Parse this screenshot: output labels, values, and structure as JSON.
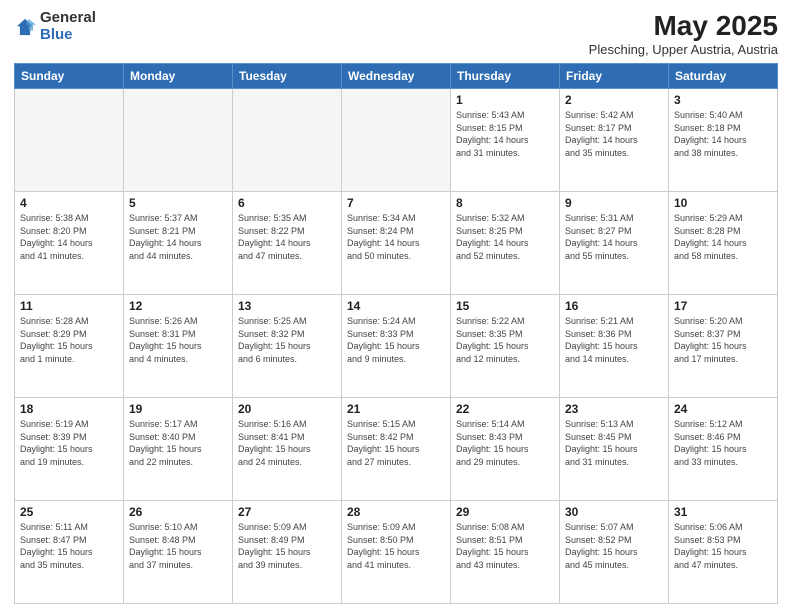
{
  "header": {
    "logo_general": "General",
    "logo_blue": "Blue",
    "title": "May 2025",
    "subtitle": "Plesching, Upper Austria, Austria"
  },
  "days_of_week": [
    "Sunday",
    "Monday",
    "Tuesday",
    "Wednesday",
    "Thursday",
    "Friday",
    "Saturday"
  ],
  "weeks": [
    [
      {
        "day": "",
        "info": ""
      },
      {
        "day": "",
        "info": ""
      },
      {
        "day": "",
        "info": ""
      },
      {
        "day": "",
        "info": ""
      },
      {
        "day": "1",
        "info": "Sunrise: 5:43 AM\nSunset: 8:15 PM\nDaylight: 14 hours\nand 31 minutes."
      },
      {
        "day": "2",
        "info": "Sunrise: 5:42 AM\nSunset: 8:17 PM\nDaylight: 14 hours\nand 35 minutes."
      },
      {
        "day": "3",
        "info": "Sunrise: 5:40 AM\nSunset: 8:18 PM\nDaylight: 14 hours\nand 38 minutes."
      }
    ],
    [
      {
        "day": "4",
        "info": "Sunrise: 5:38 AM\nSunset: 8:20 PM\nDaylight: 14 hours\nand 41 minutes."
      },
      {
        "day": "5",
        "info": "Sunrise: 5:37 AM\nSunset: 8:21 PM\nDaylight: 14 hours\nand 44 minutes."
      },
      {
        "day": "6",
        "info": "Sunrise: 5:35 AM\nSunset: 8:22 PM\nDaylight: 14 hours\nand 47 minutes."
      },
      {
        "day": "7",
        "info": "Sunrise: 5:34 AM\nSunset: 8:24 PM\nDaylight: 14 hours\nand 50 minutes."
      },
      {
        "day": "8",
        "info": "Sunrise: 5:32 AM\nSunset: 8:25 PM\nDaylight: 14 hours\nand 52 minutes."
      },
      {
        "day": "9",
        "info": "Sunrise: 5:31 AM\nSunset: 8:27 PM\nDaylight: 14 hours\nand 55 minutes."
      },
      {
        "day": "10",
        "info": "Sunrise: 5:29 AM\nSunset: 8:28 PM\nDaylight: 14 hours\nand 58 minutes."
      }
    ],
    [
      {
        "day": "11",
        "info": "Sunrise: 5:28 AM\nSunset: 8:29 PM\nDaylight: 15 hours\nand 1 minute."
      },
      {
        "day": "12",
        "info": "Sunrise: 5:26 AM\nSunset: 8:31 PM\nDaylight: 15 hours\nand 4 minutes."
      },
      {
        "day": "13",
        "info": "Sunrise: 5:25 AM\nSunset: 8:32 PM\nDaylight: 15 hours\nand 6 minutes."
      },
      {
        "day": "14",
        "info": "Sunrise: 5:24 AM\nSunset: 8:33 PM\nDaylight: 15 hours\nand 9 minutes."
      },
      {
        "day": "15",
        "info": "Sunrise: 5:22 AM\nSunset: 8:35 PM\nDaylight: 15 hours\nand 12 minutes."
      },
      {
        "day": "16",
        "info": "Sunrise: 5:21 AM\nSunset: 8:36 PM\nDaylight: 15 hours\nand 14 minutes."
      },
      {
        "day": "17",
        "info": "Sunrise: 5:20 AM\nSunset: 8:37 PM\nDaylight: 15 hours\nand 17 minutes."
      }
    ],
    [
      {
        "day": "18",
        "info": "Sunrise: 5:19 AM\nSunset: 8:39 PM\nDaylight: 15 hours\nand 19 minutes."
      },
      {
        "day": "19",
        "info": "Sunrise: 5:17 AM\nSunset: 8:40 PM\nDaylight: 15 hours\nand 22 minutes."
      },
      {
        "day": "20",
        "info": "Sunrise: 5:16 AM\nSunset: 8:41 PM\nDaylight: 15 hours\nand 24 minutes."
      },
      {
        "day": "21",
        "info": "Sunrise: 5:15 AM\nSunset: 8:42 PM\nDaylight: 15 hours\nand 27 minutes."
      },
      {
        "day": "22",
        "info": "Sunrise: 5:14 AM\nSunset: 8:43 PM\nDaylight: 15 hours\nand 29 minutes."
      },
      {
        "day": "23",
        "info": "Sunrise: 5:13 AM\nSunset: 8:45 PM\nDaylight: 15 hours\nand 31 minutes."
      },
      {
        "day": "24",
        "info": "Sunrise: 5:12 AM\nSunset: 8:46 PM\nDaylight: 15 hours\nand 33 minutes."
      }
    ],
    [
      {
        "day": "25",
        "info": "Sunrise: 5:11 AM\nSunset: 8:47 PM\nDaylight: 15 hours\nand 35 minutes."
      },
      {
        "day": "26",
        "info": "Sunrise: 5:10 AM\nSunset: 8:48 PM\nDaylight: 15 hours\nand 37 minutes."
      },
      {
        "day": "27",
        "info": "Sunrise: 5:09 AM\nSunset: 8:49 PM\nDaylight: 15 hours\nand 39 minutes."
      },
      {
        "day": "28",
        "info": "Sunrise: 5:09 AM\nSunset: 8:50 PM\nDaylight: 15 hours\nand 41 minutes."
      },
      {
        "day": "29",
        "info": "Sunrise: 5:08 AM\nSunset: 8:51 PM\nDaylight: 15 hours\nand 43 minutes."
      },
      {
        "day": "30",
        "info": "Sunrise: 5:07 AM\nSunset: 8:52 PM\nDaylight: 15 hours\nand 45 minutes."
      },
      {
        "day": "31",
        "info": "Sunrise: 5:06 AM\nSunset: 8:53 PM\nDaylight: 15 hours\nand 47 minutes."
      }
    ]
  ]
}
